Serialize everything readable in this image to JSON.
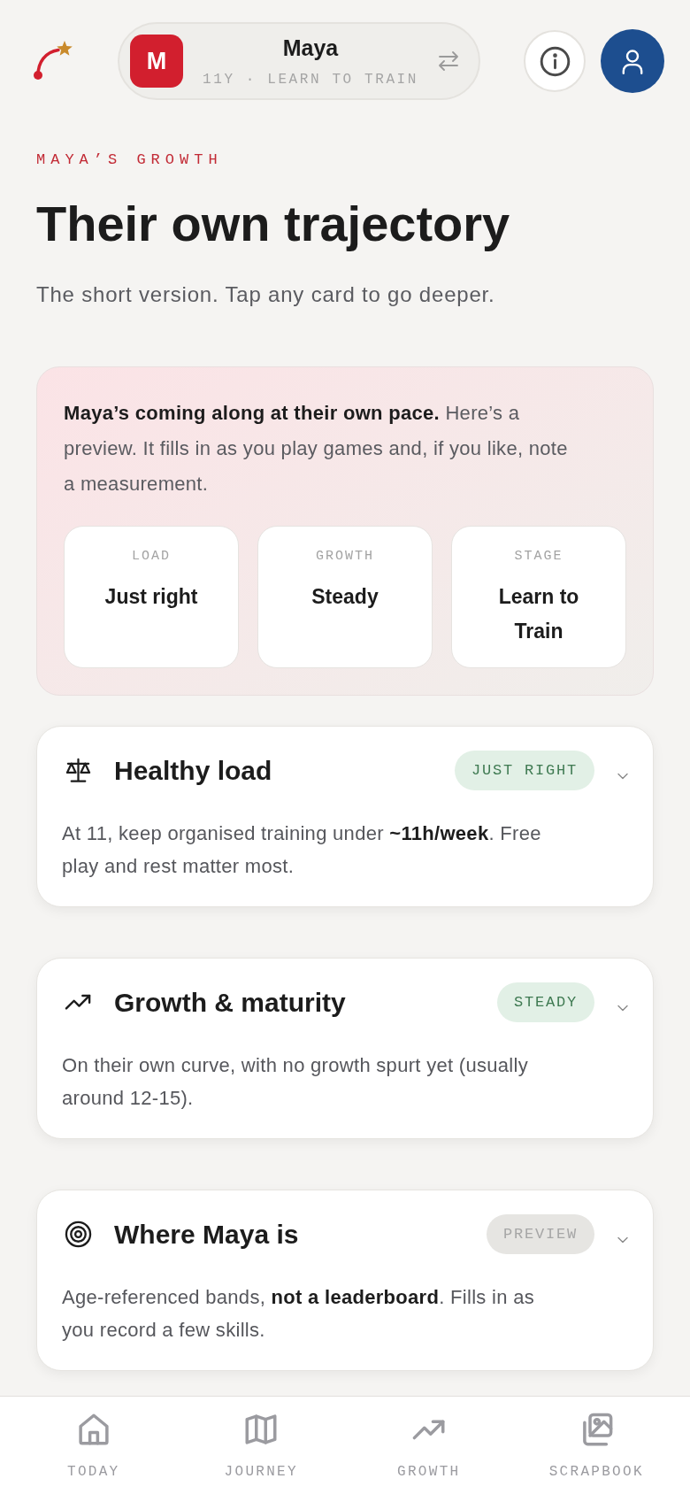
{
  "header": {
    "avatar_initial": "M",
    "name": "Maya",
    "subtitle": "11Y · LEARN TO TRAIN"
  },
  "eyebrow": "MAYA’S GROWTH",
  "title": "Their own trajectory",
  "subtitle": "The short version. Tap any card to go deeper.",
  "summary": {
    "text": "**Maya’s coming along at their own pace.** Here’s a preview. It fills in as you play games and, if you like, note a measurement.",
    "stats": [
      {
        "label": "LOAD",
        "value": "Just right"
      },
      {
        "label": "GROWTH",
        "value": "Steady"
      },
      {
        "label": "STAGE",
        "value": "Learn to Train"
      }
    ]
  },
  "cards": [
    {
      "kind": "load",
      "title": "Healthy load",
      "badge": {
        "text": "JUST RIGHT",
        "kind": "positive"
      },
      "expanded": false,
      "body": "At 11, keep organised training under **~11h/week**. Free play and rest matter most."
    },
    {
      "kind": "growth",
      "title": "Growth & maturity",
      "badge": {
        "text": "STEADY",
        "kind": "positive"
      },
      "expanded": false,
      "body": "On their own curve, with no growth spurt yet (usually around 12-15)."
    },
    {
      "kind": "position",
      "title": "Where Maya is",
      "badge": {
        "text": "PREVIEW",
        "kind": "muted"
      },
      "expanded": false,
      "body": "Age-referenced bands, **not a leaderboard**. Fills in as you record a few skills."
    }
  ],
  "bottom_nav": [
    {
      "kind": "today",
      "label": "TODAY",
      "selected": false
    },
    {
      "kind": "journey",
      "label": "JOURNEY",
      "selected": false
    },
    {
      "kind": "growth",
      "label": "GROWTH",
      "selected": false
    },
    {
      "kind": "scrapbook",
      "label": "SCRAPBOOK",
      "selected": false
    }
  ]
}
